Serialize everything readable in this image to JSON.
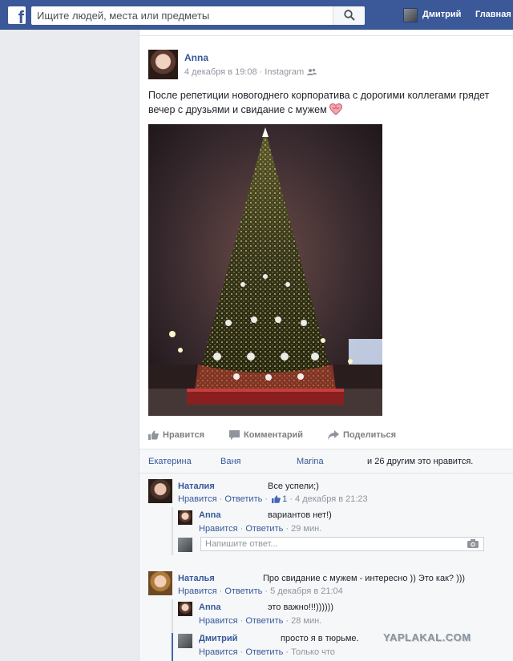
{
  "topbar": {
    "logo_letter": "f",
    "search_placeholder": "Ищите людей, места или предметы",
    "user_name": "Дмитрий",
    "home_label": "Главная"
  },
  "post": {
    "author": "Anna",
    "time": "4 декабря в 19:08",
    "source": "Instagram",
    "text": "После репетиции новогоднего корпоратива с дорогими коллегами грядет вечер с друзьями и свидание с мужем",
    "audience_icon": "friends-icon",
    "emoji_icon": "heart-icon"
  },
  "actions": {
    "like": "Нравится",
    "comment": "Комментарий",
    "share": "Поделиться"
  },
  "likes": {
    "names": [
      "Екатерина",
      "Ваня",
      "Marina"
    ],
    "others": "и 26 другим это нравится."
  },
  "comments": [
    {
      "name": "Наталия",
      "text": "Все успели;)",
      "like": "Нравится",
      "reply": "Ответить",
      "like_count": "1",
      "time": "4 декабря в 21:23",
      "replies": [
        {
          "name": "Anna",
          "text": "вариантов нет!)",
          "like": "Нравится",
          "reply": "Ответить",
          "time": "29 мин."
        }
      ]
    },
    {
      "name": "Наталья",
      "text": "Про свидание с мужем - интересно )) Это как? )))",
      "like": "Нравится",
      "reply": "Ответить",
      "time": "5 декабря в 21:04",
      "replies": [
        {
          "name": "Anna",
          "text": "это важно!!!))))))",
          "like": "Нравится",
          "reply": "Ответить",
          "time": "28 мин."
        },
        {
          "name": "Дмитрий",
          "text": "просто я в тюрьме.",
          "like": "Нравится",
          "reply": "Ответить",
          "time": "Только что"
        }
      ]
    }
  ],
  "reply_box": {
    "placeholder": "Напишите ответ..."
  },
  "watermark": "YAPLAKAL.COM",
  "colors": {
    "header": "#3b5998",
    "link": "#365899",
    "meta": "#90949c",
    "background": "#e9ebee"
  }
}
